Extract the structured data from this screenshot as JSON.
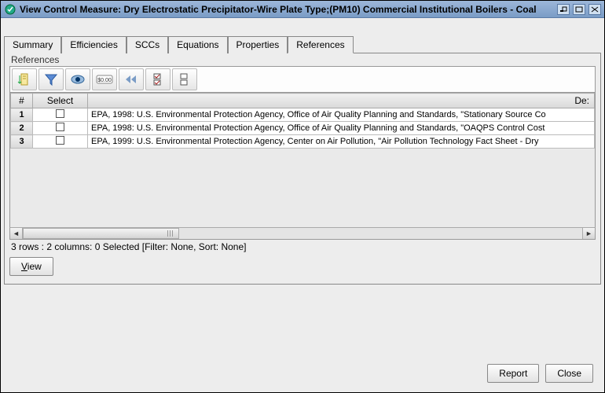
{
  "window": {
    "title": "View Control Measure: Dry Electrostatic Precipitator-Wire Plate Type;(PM10) Commercial Institutional Boilers - Coal"
  },
  "tabs": [
    {
      "label": "Summary"
    },
    {
      "label": "Efficiencies"
    },
    {
      "label": "SCCs"
    },
    {
      "label": "Equations"
    },
    {
      "label": "Properties"
    },
    {
      "label": "References",
      "active": true
    }
  ],
  "fieldset": {
    "label": "References"
  },
  "table": {
    "headers": {
      "num": "#",
      "select": "Select",
      "desc": "De:"
    },
    "rows": [
      {
        "n": "1",
        "desc": "EPA, 1998: U.S. Environmental Protection Agency, Office of Air Quality Planning and Standards, \"Stationary Source Co"
      },
      {
        "n": "2",
        "desc": "EPA, 1998: U.S. Environmental Protection Agency, Office of Air Quality Planning and Standards, \"OAQPS Control Cost"
      },
      {
        "n": "3",
        "desc": "EPA, 1999:  U.S. Environmental Protection Agency, Center on Air Pollution, \"Air Pollution Technology Fact Sheet - Dry "
      }
    ]
  },
  "status": "3 rows : 2 columns: 0 Selected [Filter: None, Sort: None]",
  "buttons": {
    "view": "View",
    "report": "Report",
    "close": "Close"
  },
  "toolbar_icons": [
    "sort-icon",
    "filter-icon",
    "show-hide-icon",
    "format-icon",
    "first-icon",
    "select-all-icon",
    "deselect-all-icon"
  ]
}
